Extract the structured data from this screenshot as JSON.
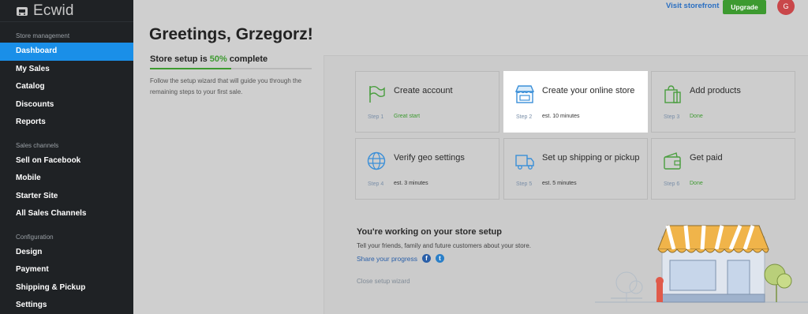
{
  "sidebar": {
    "logo_text": "Ecwid",
    "sections": [
      {
        "label": "Store management",
        "items": [
          "Dashboard",
          "My Sales",
          "Catalog",
          "Discounts",
          "Reports"
        ]
      },
      {
        "label": "Sales channels",
        "items": [
          "Sell on Facebook",
          "Mobile",
          "Starter Site",
          "All Sales Channels"
        ]
      },
      {
        "label": "Configuration",
        "items": [
          "Design",
          "Payment",
          "Shipping & Pickup",
          "Settings"
        ]
      }
    ],
    "active_item": "Dashboard"
  },
  "header": {
    "visit_storefront": "Visit storefront",
    "upgrade": "Upgrade",
    "avatar_initial": "G"
  },
  "main": {
    "greeting": "Greetings, Grzegorz!",
    "progress": {
      "prefix": "Store setup is ",
      "percent_text": "50%",
      "suffix": " complete",
      "value": 0.5,
      "description": "Follow the setup wizard that will guide you through the remaining steps to your first sale."
    },
    "steps": [
      {
        "title": "Create account",
        "step": "Step 1",
        "meta": "Great start",
        "done": true,
        "icon": "flag-icon"
      },
      {
        "title": "Create your online store",
        "step": "Step 2",
        "meta": "est. 10 minutes",
        "done": false,
        "icon": "storefront-icon"
      },
      {
        "title": "Add products",
        "step": "Step 3",
        "meta": "Done",
        "done": true,
        "icon": "shopping-bag-icon"
      },
      {
        "title": "Verify geo settings",
        "step": "Step 4",
        "meta": "est. 3 minutes",
        "done": false,
        "icon": "globe-icon"
      },
      {
        "title": "Set up shipping or pickup",
        "step": "Step 5",
        "meta": "est. 5 minutes",
        "done": false,
        "icon": "truck-icon"
      },
      {
        "title": "Get paid",
        "step": "Step 6",
        "meta": "Done",
        "done": true,
        "icon": "wallet-icon"
      }
    ],
    "promo": {
      "title": "You're working on your store setup",
      "text": "Tell your friends, family and future customers about your store.",
      "share": "Share your progress",
      "close": "Close setup wizard"
    }
  },
  "colors": {
    "accent": "#1a8fe8",
    "success": "#3d9a30",
    "sidebar_bg": "#1f2225"
  }
}
